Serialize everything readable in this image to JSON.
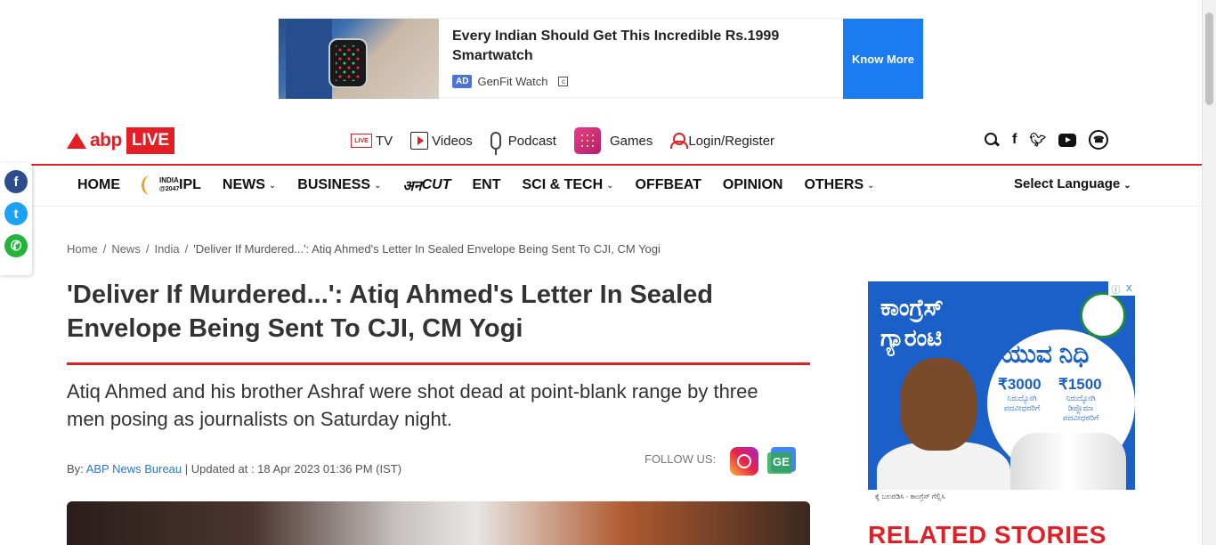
{
  "ad_banner": {
    "headline": "Every Indian Should Get This Incredible Rs.1999 Smartwatch",
    "ad_tag": "AD",
    "sponsor": "GenFit Watch",
    "cta": "Know More"
  },
  "header": {
    "logo_text": "abp",
    "logo_badge": "LIVE",
    "top_nav": [
      {
        "label": "TV",
        "icon": "live-tv-icon"
      },
      {
        "label": "Videos",
        "icon": "video-play-icon"
      },
      {
        "label": "Podcast",
        "icon": "microphone-icon"
      },
      {
        "label": "Games",
        "icon": "games-icon"
      },
      {
        "label": "Login/Register",
        "icon": "user-icon"
      }
    ],
    "live_tv_icon_text": "LIVE",
    "social_icons": [
      "search-icon",
      "facebook-icon",
      "twitter-icon",
      "youtube-icon",
      "phone-icon"
    ]
  },
  "main_nav": {
    "items": [
      {
        "label": "HOME"
      },
      {
        "label": "INDIA @2047"
      },
      {
        "label": "IPL"
      },
      {
        "label": "NEWS",
        "dropdown": true
      },
      {
        "label": "BUSINESS",
        "dropdown": true
      },
      {
        "label": "अनCUT"
      },
      {
        "label": "ENT"
      },
      {
        "label": "SCI & TECH",
        "dropdown": true
      },
      {
        "label": "OFFBEAT"
      },
      {
        "label": "OPINION"
      },
      {
        "label": "OTHERS",
        "dropdown": true
      }
    ],
    "india_logo_top": "INDIA",
    "india_logo_bottom": "@2047",
    "ancut_prefix": "अन",
    "ancut_suffix": "CUT",
    "language": "Select Language"
  },
  "share_bar": [
    "facebook-share-icon",
    "twitter-share-icon",
    "whatsapp-share-icon"
  ],
  "breadcrumb": {
    "home": "Home",
    "sep1": "/",
    "news": "News",
    "sep2": "/",
    "india": "India",
    "sep3": "/",
    "current": "'Deliver If Murdered...': Atiq Ahmed's Letter In Sealed Envelope Being Sent To CJI, CM Yogi"
  },
  "article": {
    "title": "'Deliver If Murdered...': Atiq Ahmed's Letter In Sealed Envelope Being Sent To CJI, CM Yogi",
    "summary": "Atiq Ahmed and his brother Ashraf were shot dead at point-blank range by three men posing as journalists on Saturday night.",
    "by_label": "By:",
    "author": "ABP News Bureau",
    "updated": " | Updated at : 18 Apr 2023 01:36 PM (IST)",
    "follow_label": "FOLLOW US:"
  },
  "side_ad": {
    "heading": "ಕಾಂಗ್ರೆಸ್ ಗ್ಯಾರಂಟಿ",
    "scheme": "ಯುವ ನಿಧಿ",
    "amount1": "₹3000",
    "amount2": "₹1500",
    "sub1": "ನಿರುದ್ಯೋಗಿ ಪದವೀಧರರಿಗೆ",
    "sub2": "ನಿರುದ್ಯೋಗಿ ಡಿಪ್ಲೊಮಾ ಪದವೀಧರರಿಗೆ",
    "footer": "ಕೈ ಬಲಪಡಿಸಿ · ಕಾಂಗ್ರೆಸ್ ಗೆಲ್ಲಿಸಿ",
    "info": "ⓘ",
    "close": "X"
  },
  "related_heading": "RELATED STORIES",
  "colors": {
    "brand_red": "#e31e24",
    "link_blue": "#2878d0",
    "ad_cta_blue": "#1a7cf0"
  }
}
